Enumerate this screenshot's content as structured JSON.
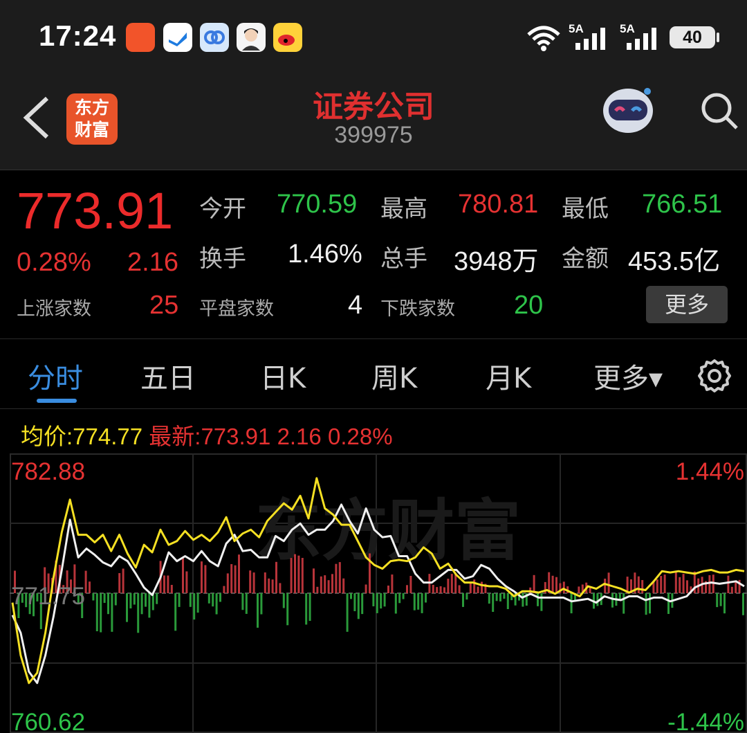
{
  "status": {
    "time": "17:24",
    "net1": "5A",
    "net2": "5A",
    "battery": "40"
  },
  "header": {
    "logo": "东方\n财富",
    "title": "证券公司",
    "code": "399975"
  },
  "quote": {
    "price": "773.91",
    "change_pct": "0.28%",
    "change": "2.16",
    "open_label": "今开",
    "open": "770.59",
    "high_label": "最高",
    "high": "780.81",
    "low_label": "最低",
    "low": "766.51",
    "turnover_label": "换手",
    "turnover": "1.46%",
    "volume_label": "总手",
    "volume": "3948万",
    "amount_label": "金额",
    "amount": "453.5亿",
    "up_label": "上涨家数",
    "up": "25",
    "flat_label": "平盘家数",
    "flat": "4",
    "down_label": "下跌家数",
    "down": "20",
    "more": "更多"
  },
  "tabs": [
    {
      "label": "分时",
      "active": true
    },
    {
      "label": "五日"
    },
    {
      "label": "日K"
    },
    {
      "label": "周K"
    },
    {
      "label": "月K"
    },
    {
      "label": "更多▾"
    }
  ],
  "info": {
    "avg_label": "均价:",
    "avg": "774.77",
    "latest_label": "最新:",
    "latest": "773.91",
    "latest_chg": "2.16",
    "latest_pct": "0.28%"
  },
  "chart_data": {
    "type": "line",
    "y_max_label": "782.88",
    "y_mid_label": "771.75",
    "y_min_label": "760.62",
    "pct_max_label": "1.44%",
    "pct_min_label": "-1.44%",
    "ylim": [
      760.62,
      782.88
    ],
    "prev_close": 771.75,
    "watermark": "东方财富",
    "series": [
      {
        "values": [
          770.0,
          768.6,
          765.5,
          764.6,
          766.8,
          769.9,
          773.6,
          777.6,
          774.6,
          775.3,
          774.8,
          774.2,
          773.9,
          774.7,
          774.3,
          773.3,
          772.2,
          771.6,
          773.0,
          775.0,
          774.3,
          774.7,
          774.3,
          775.1,
          774.3,
          773.9,
          775.7,
          776.4,
          775.1,
          775.2,
          774.6,
          774.6,
          776.3,
          775.9,
          776.8,
          777.3,
          776.4,
          776.8,
          776.8,
          777.5,
          778.8,
          777.5,
          776.5,
          778.5,
          776.8,
          776.2,
          776.3,
          774.7,
          774.7,
          773.3,
          772.6,
          772.6,
          773.1,
          773.6,
          773.6,
          772.9,
          773.1,
          774.0,
          773.7,
          772.9,
          772.3,
          771.9,
          771.4,
          771.7,
          771.4,
          771.4,
          771.4,
          771.4,
          771.1,
          771.2,
          771.3,
          771.0,
          771.5,
          771.3,
          771.2,
          771.5,
          771.5,
          771.2,
          771.4,
          771.4,
          771.1,
          771.3,
          771.5,
          772.2,
          772.5,
          772.6,
          772.5,
          772.6,
          772.7,
          772.3
        ]
      },
      {
        "values": [
          771.0,
          766.8,
          764.6,
          765.4,
          768.6,
          773.0,
          776.6,
          779.2,
          776.4,
          776.4,
          775.8,
          776.4,
          775.1,
          776.4,
          774.9,
          773.8,
          775.6,
          775.0,
          776.8,
          775.6,
          775.9,
          776.7,
          776.0,
          776.4,
          775.9,
          776.6,
          777.8,
          775.9,
          776.5,
          776.8,
          776.2,
          777.5,
          778.2,
          778.9,
          778.4,
          779.5,
          777.7,
          780.9,
          778.5,
          778.0,
          777.2,
          777.2,
          775.9,
          774.6,
          774.0,
          773.7,
          774.3,
          774.4,
          774.3,
          774.6,
          775.4,
          774.9,
          773.7,
          774.1,
          773.2,
          772.6,
          772.6,
          772.4,
          772.3,
          772.3,
          772.1,
          771.5,
          771.9,
          771.9,
          771.8,
          772.0,
          771.7,
          772.1,
          771.8,
          771.5,
          772.3,
          772.1,
          772.5,
          772.3,
          772.1,
          771.8,
          772.1,
          772.0,
          772.7,
          773.5,
          773.4,
          773.5,
          773.4,
          773.3,
          773.5,
          773.6,
          773.4,
          773.4,
          773.6,
          773.5
        ]
      }
    ]
  },
  "colors": {
    "up": "#e63232",
    "down": "#2ec44a",
    "price_line": "#f0f0f0",
    "avg_line": "#f5e023",
    "accent": "#3a8de0"
  }
}
